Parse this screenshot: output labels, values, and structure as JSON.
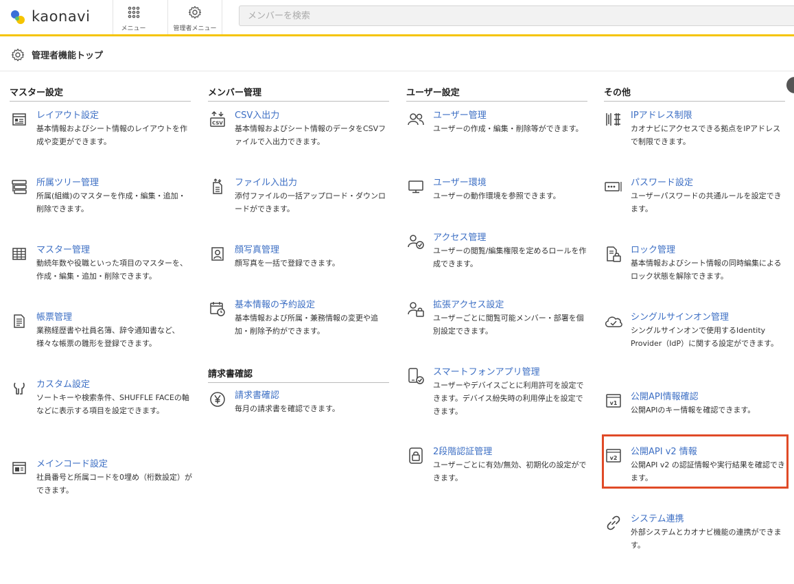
{
  "header": {
    "logo_text": "kaonavi",
    "menu_label": "メニュー",
    "admin_menu_label": "管理者メニュー",
    "search_placeholder": "メンバーを検索"
  },
  "page": {
    "title": "管理者機能トップ"
  },
  "columns": [
    {
      "heading": "マスター設定",
      "items": [
        {
          "name": "レイアウト設定",
          "desc": "基本情報およびシート情報のレイアウトを作成や変更ができます。",
          "icon": "layout-icon"
        },
        {
          "name": "所属ツリー管理",
          "desc": "所属(組織)のマスターを作成・編集・追加・削除できます。",
          "icon": "tree-icon"
        },
        {
          "name": "マスター管理",
          "desc": "動続年数や役職といった項目のマスターを、作成・編集・追加・削除できます。",
          "icon": "table-icon"
        },
        {
          "name": "帳票管理",
          "desc": "業務経歴書や社員名簿、辞令通知書など、様々な帳票の雛形を登録できます。",
          "icon": "document-icon"
        },
        {
          "name": "カスタム設定",
          "desc": "ソートキーや検索条件、SHUFFLE FACEの軸などに表示する項目を設定できます。",
          "icon": "wrench-icon"
        },
        {
          "name": "メインコード設定",
          "desc": "社員番号と所属コードを0埋め（桁数設定）ができます。",
          "icon": "code-icon"
        }
      ]
    },
    {
      "heading": "メンバー管理",
      "items": [
        {
          "name": "CSV入出力",
          "desc": "基本情報およびシート情報のデータをCSVファイルで入出力できます。",
          "icon": "csv-icon"
        },
        {
          "name": "ファイル入出力",
          "desc": "添付ファイルの一括アップロード・ダウンロードができます。",
          "icon": "file-transfer-icon"
        },
        {
          "name": "顔写真管理",
          "desc": "顔写真を一括で登録できます。",
          "icon": "portrait-icon"
        },
        {
          "name": "基本情報の予約設定",
          "desc": "基本情報および所属・兼務情報の変更や追加・削除予約ができます。",
          "icon": "calendar-clock-icon"
        }
      ],
      "heading2": "請求書確認",
      "items2": [
        {
          "name": "請求書確認",
          "desc": "毎月の請求書を確認できます。",
          "icon": "yen-icon"
        }
      ]
    },
    {
      "heading": "ユーザー設定",
      "items": [
        {
          "name": "ユーザー管理",
          "desc": "ユーザーの作成・編集・削除等ができます。",
          "icon": "users-icon"
        },
        {
          "name": "ユーザー環境",
          "desc": "ユーザーの動作環境を参照できます。",
          "icon": "monitor-icon"
        },
        {
          "name": "アクセス管理",
          "desc": "ユーザーの閲覧/編集権限を定めるロールを作成できます。",
          "icon": "user-check-icon"
        },
        {
          "name": "拡張アクセス設定",
          "desc": "ユーザーごとに閲覧可能メンバー・部署を個別設定できます。",
          "icon": "user-lock-icon"
        },
        {
          "name": "スマートフォンアプリ管理",
          "desc": "ユーザーやデバイスごとに利用許可を設定できます。デバイス紛失時の利用停止を設定できます。",
          "icon": "smartphone-check-icon"
        },
        {
          "name": "2段階認証管理",
          "desc": "ユーザーごとに有効/無効、初期化の設定ができます。",
          "icon": "two-factor-icon"
        }
      ]
    },
    {
      "heading": "その他",
      "items": [
        {
          "name": "IPアドレス制限",
          "desc": "カオナビにアクセスできる拠点をIPアドレスで制限できます。",
          "icon": "ip-icon"
        },
        {
          "name": "パスワード設定",
          "desc": "ユーザーパスワードの共通ルールを設定できます。",
          "icon": "password-icon"
        },
        {
          "name": "ロック管理",
          "desc": "基本情報およびシート情報の同時編集によるロック状態を解除できます。",
          "icon": "file-lock-icon"
        },
        {
          "name": "シングルサインオン管理",
          "desc": "シングルサインオンで使用するIdentity Provider（IdP）に関する設定ができます。",
          "icon": "cloud-icon"
        },
        {
          "name": "公開API情報確認",
          "desc": "公開APIのキー情報を確認できます。",
          "icon": "api-v1-icon"
        },
        {
          "name": "公開API v2 情報",
          "desc": "公開API v2 の認証情報や実行結果を確認できます。",
          "icon": "api-v2-icon"
        },
        {
          "name": "システム連携",
          "desc": "外部システムとカオナビ機能の連携ができます。",
          "icon": "link-icon"
        }
      ]
    }
  ],
  "colors": {
    "accent_yellow": "#f5c400",
    "link_blue": "#3d6fc4",
    "highlight_red": "#e04a27"
  }
}
